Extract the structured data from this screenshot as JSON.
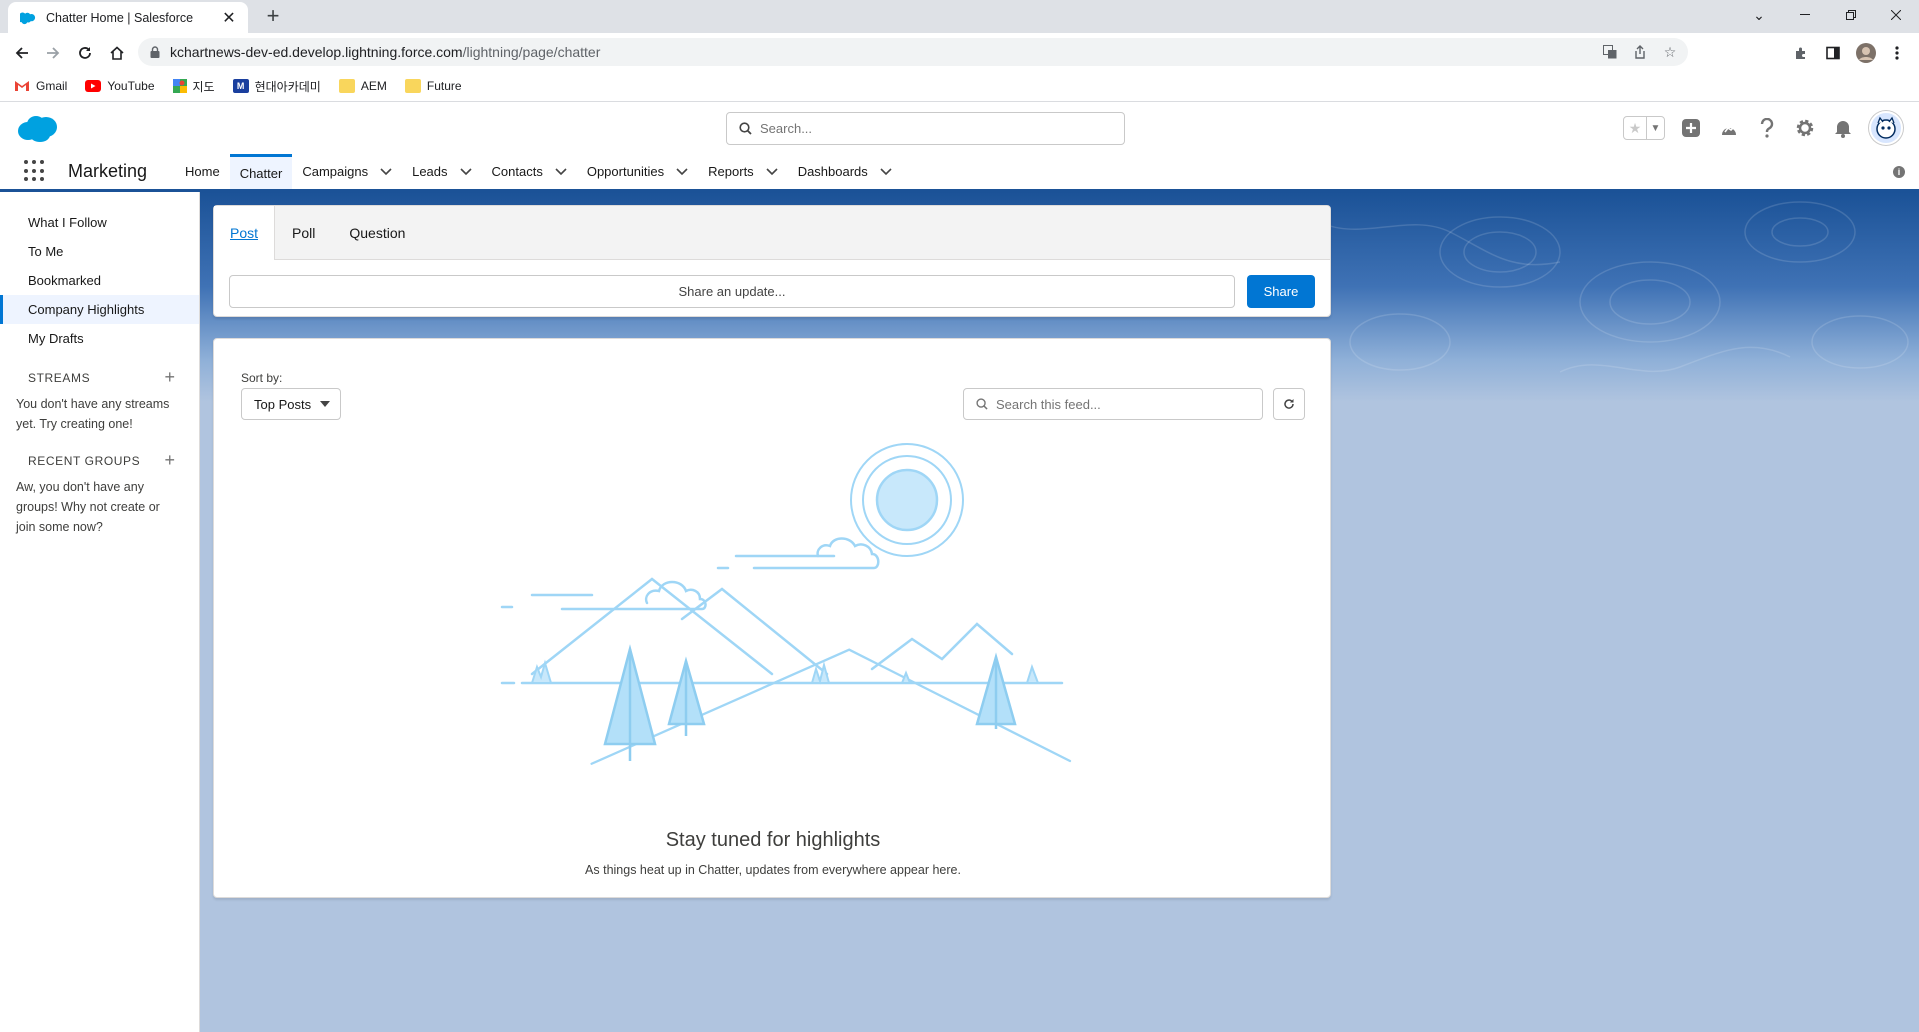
{
  "browser": {
    "tab_title": "Chatter Home | Salesforce",
    "url_host": "kchartnews-dev-ed.develop.lightning.force.com",
    "url_path": "/lightning/page/chatter",
    "bookmarks": [
      {
        "label": "Gmail",
        "color": "#ea4335"
      },
      {
        "label": "YouTube",
        "color": "#ff0000"
      },
      {
        "label": "지도",
        "color": "#34a853"
      },
      {
        "label": "현대아카데미",
        "color": "#1a3f9e"
      },
      {
        "label": "AEM",
        "color": "#f9d65c"
      },
      {
        "label": "Future",
        "color": "#f9d65c"
      }
    ]
  },
  "header": {
    "search_placeholder": "Search..."
  },
  "nav": {
    "app_name": "Marketing",
    "items": [
      {
        "label": "Home",
        "dropdown": false
      },
      {
        "label": "Chatter",
        "dropdown": false
      },
      {
        "label": "Campaigns",
        "dropdown": true
      },
      {
        "label": "Leads",
        "dropdown": true
      },
      {
        "label": "Contacts",
        "dropdown": true
      },
      {
        "label": "Opportunities",
        "dropdown": true
      },
      {
        "label": "Reports",
        "dropdown": true
      },
      {
        "label": "Dashboards",
        "dropdown": true
      }
    ]
  },
  "sidebar": {
    "links": [
      "What I Follow",
      "To Me",
      "Bookmarked",
      "Company Highlights",
      "My Drafts"
    ],
    "streams_heading": "STREAMS",
    "streams_empty": "You don't have any streams yet. Try creating one!",
    "groups_heading": "RECENT GROUPS",
    "groups_empty": "Aw, you don't have any groups! Why not create or join some now?"
  },
  "publisher": {
    "tabs": [
      "Post",
      "Poll",
      "Question"
    ],
    "input_placeholder": "Share an update...",
    "share_label": "Share"
  },
  "feed": {
    "sort_label": "Sort by:",
    "sort_value": "Top Posts",
    "search_placeholder": "Search this feed...",
    "empty_title": "Stay tuned for highlights",
    "empty_subtitle": "As things heat up in Chatter, updates from everywhere appear here."
  },
  "colors": {
    "brand": "#0176d3",
    "nav_border": "#1b5297",
    "illustration": "#8ecdf0"
  }
}
